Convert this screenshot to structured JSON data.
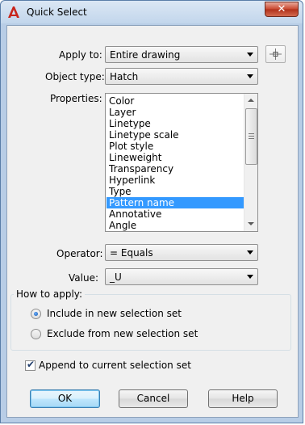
{
  "window": {
    "title": "Quick Select",
    "close_label": "✕"
  },
  "apply_to": {
    "label": "Apply to:",
    "value": "Entire drawing"
  },
  "object_type": {
    "label": "Object type:",
    "value": "Hatch"
  },
  "properties": {
    "label": "Properties:",
    "items": [
      "Color",
      "Layer",
      "Linetype",
      "Linetype scale",
      "Plot style",
      "Lineweight",
      "Transparency",
      "Hyperlink",
      "Type",
      "Pattern name",
      "Annotative",
      "Angle"
    ],
    "selected": "Pattern name"
  },
  "operator": {
    "label": "Operator:",
    "value": "= Equals"
  },
  "value": {
    "label": "Value:",
    "value": "_U"
  },
  "how_to_apply": {
    "title": "How to apply:",
    "include_label": "Include in new selection set",
    "exclude_label": "Exclude from new selection set",
    "selected": "include"
  },
  "append": {
    "label": "Append to current selection set",
    "checked": true
  },
  "buttons": {
    "ok": "OK",
    "cancel": "Cancel",
    "help": "Help"
  },
  "icons": {
    "app": "autocad-icon",
    "pick": "select-objects-icon"
  },
  "colors": {
    "selection": "#3399ff",
    "titlebar": "#c2d6ec"
  }
}
